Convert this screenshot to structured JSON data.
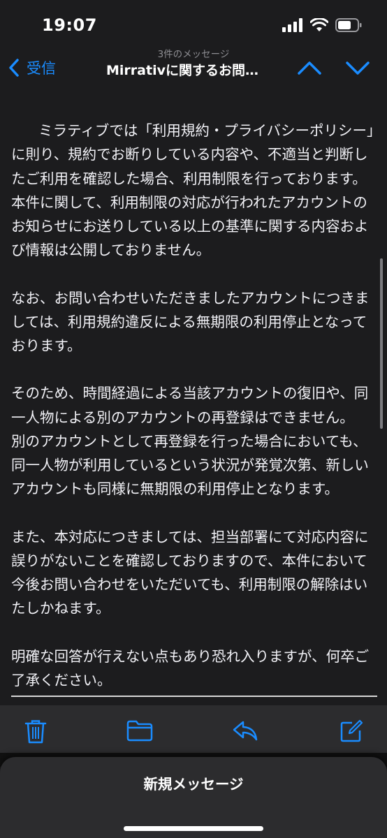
{
  "status_bar": {
    "time": "19:07"
  },
  "nav": {
    "back_label": "受信",
    "subtitle": "3件のメッセージ",
    "title": "Mirrativに関するお問…"
  },
  "message": {
    "paragraphs": [
      "ミラティブでは「利用規約・プライバシーポリシー」に則り、規約でお断りしている内容や、不適当と判断したご利用を確認した場合、利用制限を行っております。\n本件に関して、利用制限の対応が行われたアカウントのお知らせにお送りしている以上の基準に関する内容および情報は公開しておりません。",
      "なお、お問い合わせいただきましたアカウントにつきましては、利用規約違反による無期限の利用停止となっております。",
      "そのため、時間経過による当該アカウントの復旧や、同一人物による別のアカウントの再登録はできません。\n別のアカウントとして再登録を行った場合においても、同一人物が利用しているという状況が発覚次第、新しいアカウントも同様に無期限の利用停止となります。",
      "また、本対応につきましては、担当部署にて対応内容に誤りがないことを確認しておりますので、本件において今後お問い合わせをいただいても、利用制限の解除はいたしかねます。",
      "明確な回答が行えない点もあり恐れ入りますが、何卒ご了承ください。"
    ]
  },
  "toolbar": {
    "icons": [
      "trash-icon",
      "folder-icon",
      "reply-icon",
      "compose-icon"
    ]
  },
  "sheet": {
    "new_message_label": "新規メッセージ"
  },
  "colors": {
    "accent": "#1a8cff",
    "background": "#1c1c1e",
    "toolbar": "#2c2c2e",
    "text": "#f2f2f7",
    "secondary_text": "#8e8e93"
  }
}
